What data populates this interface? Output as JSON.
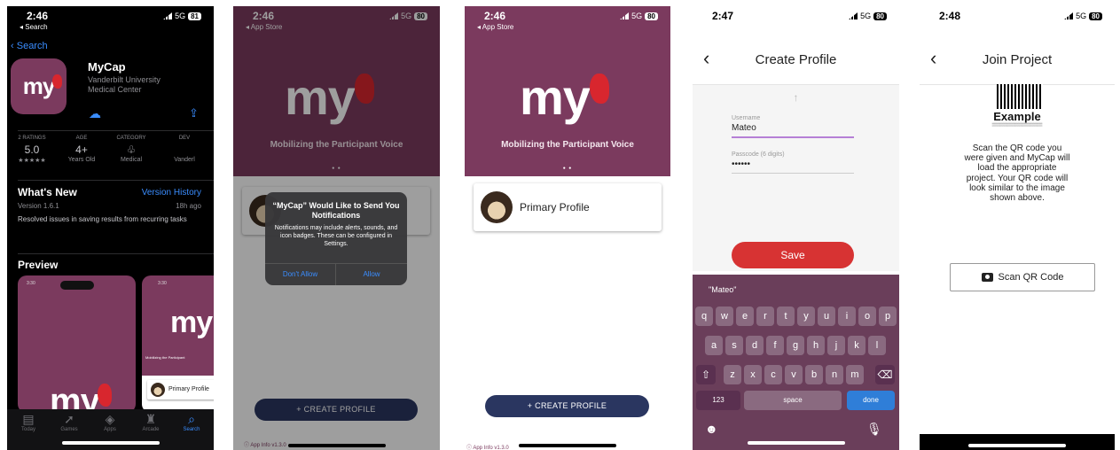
{
  "appstore": {
    "time": "2:46",
    "back_label": "◂ Search",
    "network": "5G",
    "battery": "81",
    "search_link": "Search",
    "app_name": "MyCap",
    "developer": "Vanderbilt University Medical Center",
    "stats": [
      {
        "label": "2 RATINGS",
        "value": "5.0",
        "sub": "★★★★★"
      },
      {
        "label": "AGE",
        "value": "4+",
        "sub": "Years Old"
      },
      {
        "label": "CATEGORY",
        "value": "",
        "sub": "Medical"
      },
      {
        "label": "DEV",
        "value": "",
        "sub": "Vanderl"
      }
    ],
    "whats_new": "What's New",
    "version_history": "Version History",
    "version": "Version 1.6.1",
    "ago": "18h ago",
    "notes": "Resolved issues in saving results from recurring tasks",
    "preview": "Preview",
    "preview_logo": "my",
    "preview_logo2": "my",
    "preview_tagline": "Mobilizing the Participant",
    "preview_profile": "Primary Profile",
    "preview_time": "3:30",
    "tabs": [
      "Today",
      "Games",
      "Apps",
      "Arcade",
      "Search"
    ]
  },
  "notif": {
    "time": "2:46",
    "back_label": "◂ App Store",
    "network": "5G",
    "battery": "80",
    "logo": "my",
    "tagline": "Mobilizing the Participant Voice",
    "alert_title": "“MyCap” Would Like to Send You Notifications",
    "alert_msg": "Notifications may include alerts, sounds, and icon badges. These can be configured in Settings.",
    "dont_allow": "Don't Allow",
    "allow": "Allow",
    "create_profile": "+ CREATE PROFILE",
    "app_info": "ⓘ App Info v1.3.0"
  },
  "profiles": {
    "time": "2:46",
    "back_label": "◂ App Store",
    "network": "5G",
    "battery": "80",
    "logo": "my",
    "tagline": "Mobilizing the Participant Voice",
    "profile_name": "Primary Profile",
    "create_profile": "+ CREATE PROFILE",
    "app_info": "ⓘ App Info v1.3.0"
  },
  "create": {
    "time": "2:47",
    "network": "5G",
    "battery": "80",
    "title": "Create Profile",
    "username_label": "Username",
    "username_value": "Mateo",
    "passcode_label": "Passcode (6 digits)",
    "passcode_value": "••••••",
    "save": "Save",
    "suggestion": "\"Mateo\"",
    "row1": [
      "q",
      "w",
      "e",
      "r",
      "t",
      "y",
      "u",
      "i",
      "o",
      "p"
    ],
    "row2": [
      "a",
      "s",
      "d",
      "f",
      "g",
      "h",
      "j",
      "k",
      "l"
    ],
    "row3": [
      "z",
      "x",
      "c",
      "v",
      "b",
      "n",
      "m"
    ],
    "key_123": "123",
    "key_space": "space",
    "key_done": "done"
  },
  "join": {
    "time": "2:48",
    "network": "5G",
    "battery": "80",
    "title": "Join Project",
    "qr_label": "Example",
    "instructions": "Scan the QR code you were given and MyCap will load the appropriate project. Your QR code will look similar to the image shown above.",
    "scan_button": "Scan QR Code"
  },
  "colors": {
    "brand_purple": "#7b3a5e",
    "accent_red": "#d73333",
    "navy_button": "#2a3660",
    "ios_blue": "#3a8dff"
  }
}
